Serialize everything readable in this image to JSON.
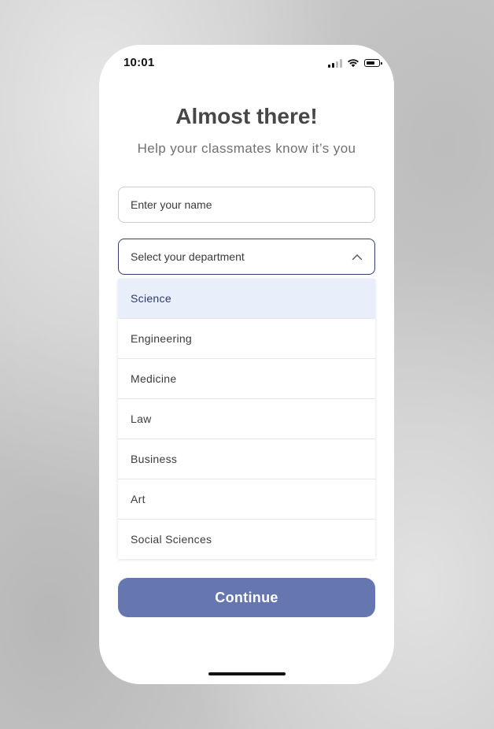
{
  "status_bar": {
    "time": "10:01",
    "icons": [
      "cellular-signal-icon",
      "wifi-icon",
      "battery-icon"
    ]
  },
  "header": {
    "title": "Almost there!",
    "subtitle": "Help your classmates know it’s you"
  },
  "form": {
    "name_placeholder": "Enter your name",
    "name_value": "",
    "department_placeholder": "Select your department",
    "department_chevron": "chevron-up-icon",
    "department_options": [
      "Science",
      "Engineering",
      "Medicine",
      "Law",
      "Business",
      "Art",
      "Social Sciences"
    ],
    "highlighted_option": "Science",
    "continue_label": "Continue"
  },
  "colors": {
    "accent": "#6677b0",
    "select_border": "#2f3f6e",
    "highlight_bg": "#e8effb",
    "title_text": "#474747"
  }
}
